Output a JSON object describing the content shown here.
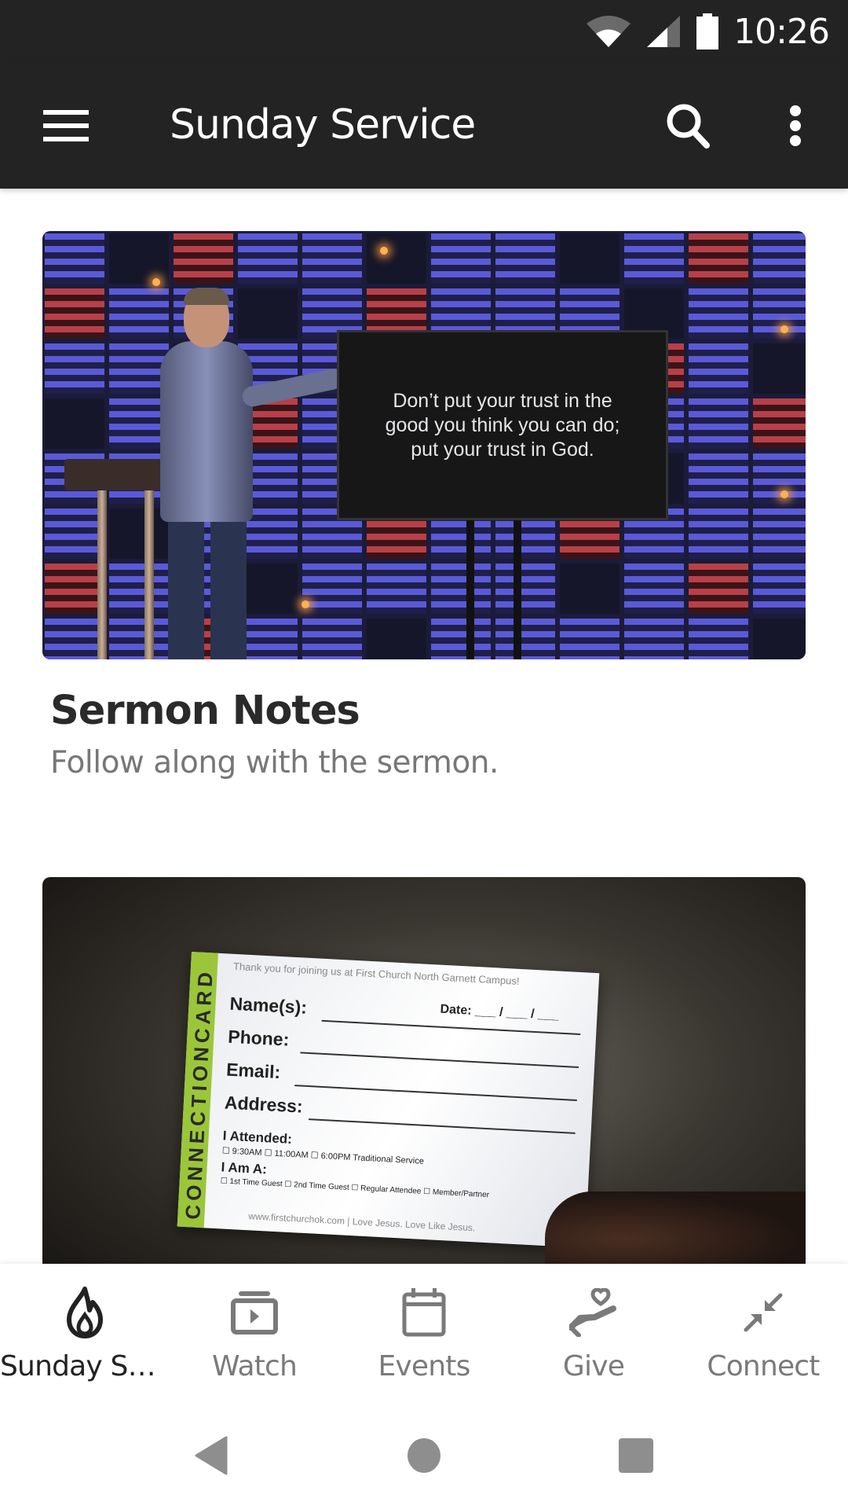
{
  "status_bar": {
    "time": "10:26",
    "icons": [
      "wifi-icon",
      "cell-signal-icon",
      "battery-icon"
    ]
  },
  "app_bar": {
    "title": "Sunday Service",
    "icons": [
      "menu-icon",
      "search-icon",
      "more-vert-icon"
    ]
  },
  "cards": [
    {
      "title": "Sermon Notes",
      "subtitle": "Follow along with the sermon.",
      "image": {
        "description": "Pastor on stage pointing at screen",
        "screen_text": "Don’t put your trust in the good you think you can do; put your trust in God."
      }
    },
    {
      "title": "",
      "subtitle": "",
      "image": {
        "description": "Hand holding a connection card",
        "card_side": "CONNECTIONCARD",
        "card_thanks": "Thank you for joining us at First Church North Garnett Campus!",
        "card_date": "Date: ___ / ___ / ___",
        "card_fields": [
          "Name(s):",
          "Phone:",
          "Email:",
          "Address:"
        ],
        "card_attended_label": "I Attended:",
        "card_attended_options": "☐ 9:30AM   ☐ 11:00AM   ☐ 6:00PM Traditional Service",
        "card_iam_label": "I Am A:",
        "card_iam_options": "☐ 1st Time Guest  ☐ 2nd Time Guest  ☐ Regular Attendee  ☐ Member/Partner",
        "card_footer": "www.firstchurchok.com | Love Jesus. Love Like Jesus."
      }
    }
  ],
  "bottom_nav": {
    "active_index": 0,
    "items": [
      {
        "label": "Sunday Ser...",
        "icon": "flame-icon"
      },
      {
        "label": "Watch",
        "icon": "video-library-icon"
      },
      {
        "label": "Events",
        "icon": "calendar-icon"
      },
      {
        "label": "Give",
        "icon": "hand-heart-icon"
      },
      {
        "label": "Connect",
        "icon": "compress-arrows-icon"
      }
    ]
  },
  "system_nav": {
    "buttons": [
      "back-icon",
      "home-icon",
      "recents-icon"
    ]
  },
  "colors": {
    "app_bar": "#232323",
    "active_nav": "#222222",
    "inactive_nav": "#7a7a7a",
    "accent_green": "#9bc63a"
  }
}
